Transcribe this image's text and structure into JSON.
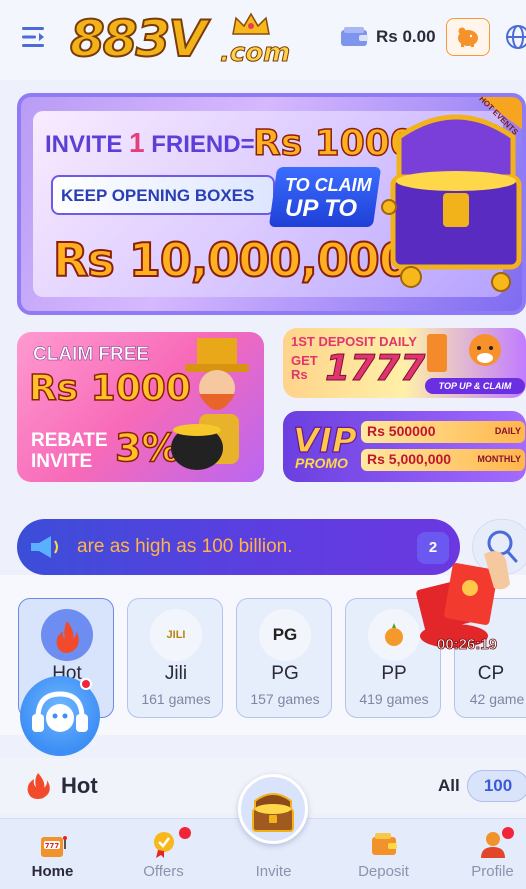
{
  "header": {
    "logo_text": "883V",
    "logo_suffix": ".com",
    "balance": "Rs 0.00",
    "icons": [
      "menu-icon",
      "wallet-icon",
      "piggy-bank-icon",
      "globe-icon"
    ]
  },
  "banner_main": {
    "invite_prefix": "INVITE",
    "invite_count": "1",
    "invite_suffix": "FRIEND=",
    "invite_amount": "Rs 1000",
    "keep_text": "KEEP OPENING BOXES",
    "claim_line1": "TO CLAIM",
    "claim_line2": "UP TO",
    "big_amount": "Rs 10,000,000",
    "hot_events": "HOT EVENTS"
  },
  "tile_claim": {
    "title": "CLAIM FREE",
    "amount": "Rs 1000",
    "rebate_line1": "REBATE",
    "rebate_line2": "INVITE",
    "rebate_pct": "3%"
  },
  "tile_deposit": {
    "title": "1ST DEPOSIT DAILY",
    "get_line1": "GET",
    "get_line2": "Rs",
    "amount": "1777",
    "button": "TOP UP & CLAIM"
  },
  "tile_vip": {
    "vip_word": "VIP",
    "promo_word": "PROMO",
    "daily_amount": "Rs 500000",
    "daily_label": "DAILY",
    "monthly_amount": "Rs 5,000,000",
    "monthly_label": "MONTHLY"
  },
  "marquee": {
    "text": "are as high as 100 billion.",
    "badge": "2"
  },
  "categories": [
    {
      "label": "Hot",
      "count": "",
      "icon": "flame-icon",
      "icon_text": "",
      "active": true
    },
    {
      "label": "Jili",
      "count": "161 games",
      "icon": "jili-logo-icon",
      "icon_text": "JILI",
      "active": false
    },
    {
      "label": "PG",
      "count": "157 games",
      "icon": "pg-logo-icon",
      "icon_text": "PG",
      "active": false
    },
    {
      "label": "PP",
      "count": "419 games",
      "icon": "pp-logo-icon",
      "icon_text": "",
      "active": false
    },
    {
      "label": "CP",
      "count": "42 game",
      "icon": "cp-logo-icon",
      "icon_text": "",
      "active": false
    }
  ],
  "hot_count_partial": "s",
  "floating": {
    "timer": "00:26:19"
  },
  "hot_section": {
    "title": "Hot",
    "all_label": "All",
    "all_count": "100"
  },
  "nav": [
    {
      "label": "Home",
      "icon": "slot-machine-icon",
      "active": true,
      "dot": false
    },
    {
      "label": "Offers",
      "icon": "offers-badge-icon",
      "active": false,
      "dot": true
    },
    {
      "label": "Invite",
      "icon": "treasure-chest-icon",
      "active": false,
      "dot": false
    },
    {
      "label": "Deposit",
      "icon": "wallet-deposit-icon",
      "active": false,
      "dot": false
    },
    {
      "label": "Profile",
      "icon": "profile-icon",
      "active": false,
      "dot": true
    }
  ],
  "colors": {
    "accent": "#5a3fe0",
    "marquee_text": "#ffb44a",
    "badge_red": "#f2243a",
    "gold": "#ffb020"
  }
}
